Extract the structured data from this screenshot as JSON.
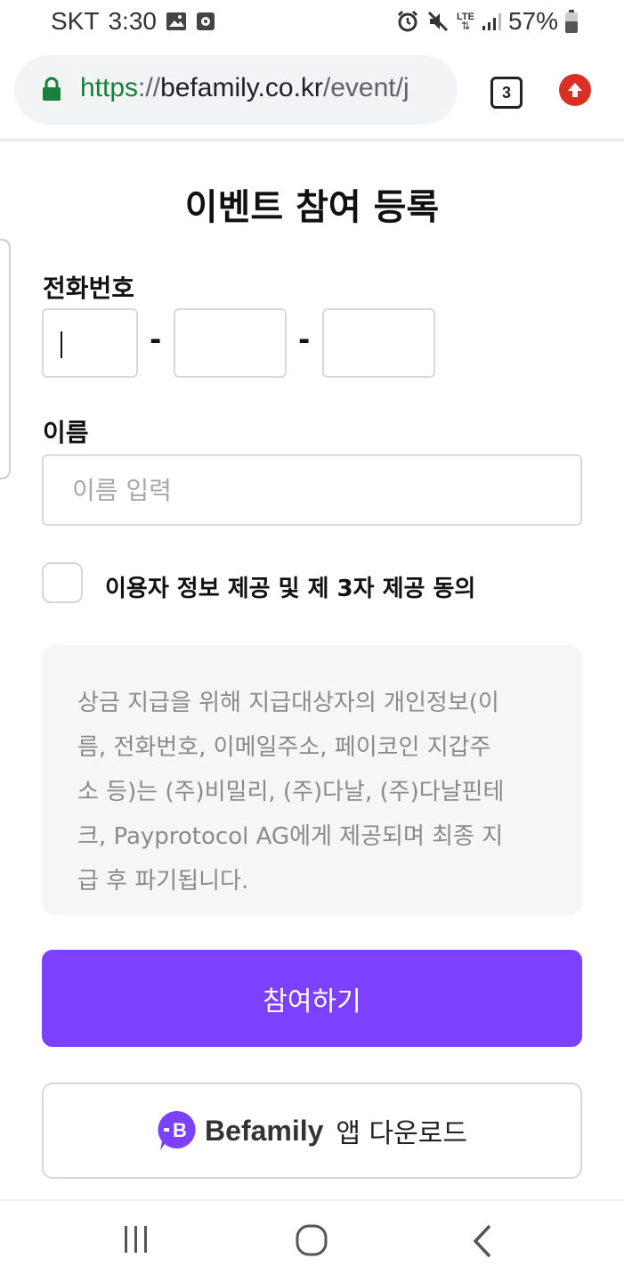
{
  "status_bar": {
    "carrier": "SKT",
    "time": "3:30",
    "network": "LTE",
    "battery": "57%"
  },
  "browser": {
    "url_scheme": "https",
    "url_separator": "://",
    "url_host": "befamily.co.kr",
    "url_path": "/event/j",
    "tab_count": "3"
  },
  "form": {
    "title": "이벤트 참여 등록",
    "phone_label": "전화번호",
    "phone_separator": "-",
    "name_label": "이름",
    "name_placeholder": "이름 입력",
    "agree_label": "이용자 정보 제공 및 제 3자 제공 동의"
  },
  "notice": {
    "lines": [
      "상금 지급을 위해 지급대상자의 개인정보(이",
      "름, 전화번호, 이메일주소, 페이코인 지갑주",
      "소 등)는 (주)비밀리, (주)다날, (주)다날핀테",
      "크, Payprotocol AG에게 제공되며 최종 지",
      "급 후 파기됩니다."
    ]
  },
  "buttons": {
    "submit_label": "참여하기",
    "download_brand": "Befamily",
    "download_label": "앱 다운로드"
  },
  "colors": {
    "accent": "#7c40ff",
    "secure_green": "#188038",
    "update_red": "#d93025"
  }
}
